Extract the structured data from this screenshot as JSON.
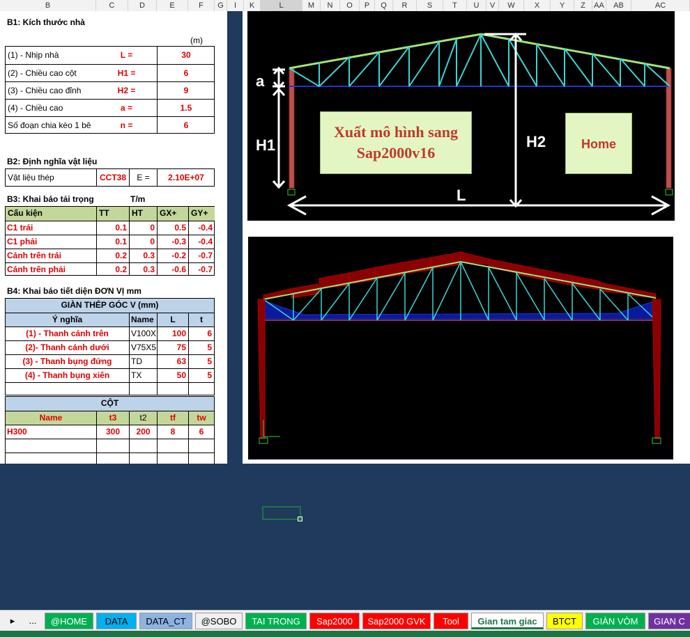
{
  "columns": [
    "B",
    "C",
    "D",
    "E",
    "F",
    "G",
    "I",
    "K",
    "L",
    "M",
    "N",
    "O",
    "P",
    "Q",
    "R",
    "S",
    "T",
    "U",
    "V",
    "W",
    "X",
    "Y",
    "Z",
    "AA",
    "AB",
    "AC"
  ],
  "b1": {
    "title": "B1: Kích thước nhà",
    "unit": "(m)",
    "rows": [
      {
        "label": "(1) - Nhịp nhà",
        "sym": "L =",
        "val": "30"
      },
      {
        "label": "(2) - Chiều cao cột",
        "sym": "H1 =",
        "val": "6"
      },
      {
        "label": "(3) - Chiều cao đỉnh",
        "sym": "H2 =",
        "val": "9"
      },
      {
        "label": "(4) - Chiều cao",
        "sym": "a =",
        "val": "1.5"
      },
      {
        "label": "Số đoạn chia kèo 1 bê",
        "sym": "n =",
        "val": "6"
      }
    ]
  },
  "b2": {
    "title": "B2: Định nghĩa vật liệu",
    "label": "Vật liệu thép",
    "material": "CCT38",
    "e_label": "E =",
    "e_val": "2.10E+07"
  },
  "b3": {
    "title": "B3: Khai báo tải trọng",
    "unit": "T/m",
    "headers": [
      "Cấu kiện",
      "TT",
      "HT",
      "GX+",
      "GY+"
    ],
    "rows": [
      {
        "name": "C1 trái",
        "tt": "0.1",
        "ht": "0",
        "gx": "0.5",
        "gy": "-0.4"
      },
      {
        "name": "C1 phải",
        "tt": "0.1",
        "ht": "0",
        "gx": "-0.3",
        "gy": "-0.4"
      },
      {
        "name": "Cánh trên trái",
        "tt": "0.2",
        "ht": "0.3",
        "gx": "-0.2",
        "gy": "-0.7"
      },
      {
        "name": "Cánh trên phải",
        "tt": "0.2",
        "ht": "0.3",
        "gx": "-0.6",
        "gy": "-0.7"
      }
    ]
  },
  "b4": {
    "title": "B4: Khai báo tiết diện ĐƠN VỊ mm",
    "truss_title": "GIÀN THÉP GÓC V (mm)",
    "headers": [
      "Ý nghĩa",
      "Name",
      "L",
      "t"
    ],
    "rows": [
      {
        "meaning": "(1) - Thanh cánh trên",
        "name": "V100X",
        "l": "100",
        "t": "6"
      },
      {
        "meaning": "(2)- Thanh cánh dưới",
        "name": "V75X5",
        "l": "75",
        "t": "5"
      },
      {
        "meaning": "(3) - Thanh bụng đứng",
        "name": "TD",
        "l": "63",
        "t": "5"
      },
      {
        "meaning": "(4) - Thanh bụng xiên",
        "name": "TX",
        "l": "50",
        "t": "5"
      }
    ],
    "col_title": "CỘT",
    "col_headers": [
      "Name",
      "t3",
      "t2",
      "tf",
      "tw"
    ],
    "col_row": {
      "name": "H300",
      "t3": "300",
      "t2": "200",
      "tf": "8",
      "tw": "6"
    }
  },
  "diagram": {
    "label_a": "a",
    "label_h1": "H1",
    "label_h2": "H2",
    "label_l": "L"
  },
  "buttons": {
    "sap_export": "Xuất mô hình sang Sap2000v16",
    "home": "Home"
  },
  "tabs": [
    "@HOME",
    "DATA",
    "DATA_CT",
    "@SOBO",
    "TAI TRONG",
    "Sap2000",
    "Sap2000 GVK",
    "Tool",
    "Gian tam giac",
    "BTCT",
    "GIÀN VÒM",
    "GIAN C"
  ],
  "tab_colors": [
    "#00b050",
    "#00b0f0",
    "#8db3e2",
    "#f0f0f0",
    "#00b050",
    "#ff0000",
    "#ff0000",
    "#ff0000",
    "#ffffff",
    "#ffff00",
    "#00b050",
    "#7030a0"
  ],
  "active_tab": "Gian tam giac",
  "nav": {
    "prev": "▸",
    "more": "..."
  }
}
